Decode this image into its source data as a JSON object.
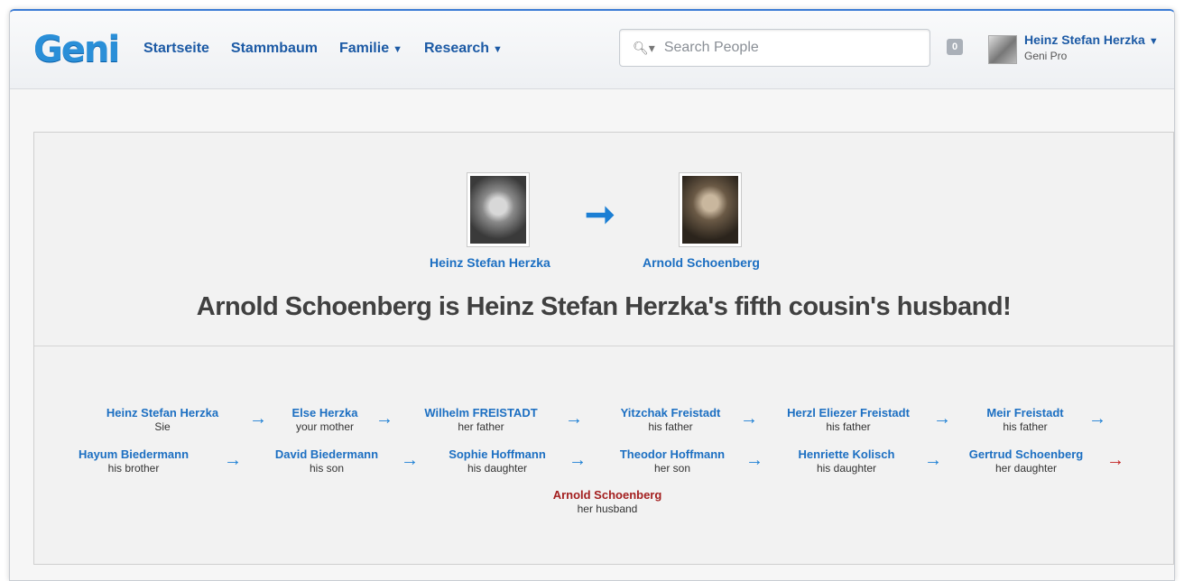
{
  "logo": "Geni",
  "nav": [
    {
      "label": "Startseite",
      "dropdown": false
    },
    {
      "label": "Stammbaum",
      "dropdown": false
    },
    {
      "label": "Familie",
      "dropdown": true
    },
    {
      "label": "Research",
      "dropdown": true
    }
  ],
  "search": {
    "placeholder": "Search People"
  },
  "notifications": {
    "count": "0"
  },
  "user": {
    "name": "Heinz Stefan Herzka",
    "subtitle": "Geni Pro"
  },
  "relationship": {
    "from": "Heinz Stefan Herzka",
    "to": "Arnold Schoenberg",
    "headline": "Arnold Schoenberg is Heinz Stefan Herzka's fifth cousin's husband!"
  },
  "path": [
    {
      "name": "Heinz Stefan Herzka",
      "relation": "Sie"
    },
    {
      "name": "Else Herzka",
      "relation": "your mother"
    },
    {
      "name": "Wilhelm FREISTADT",
      "relation": "her father"
    },
    {
      "name": "Yitzchak Freistadt",
      "relation": "his father"
    },
    {
      "name": "Herzl Eliezer Freistadt",
      "relation": "his father"
    },
    {
      "name": "Meir Freistadt",
      "relation": "his father"
    },
    {
      "name": "Hayum Biedermann",
      "relation": "his brother"
    },
    {
      "name": "David Biedermann",
      "relation": "his son"
    },
    {
      "name": "Sophie Hoffmann",
      "relation": "his daughter"
    },
    {
      "name": "Theodor Hoffmann",
      "relation": "her son"
    },
    {
      "name": "Henriette Kolisch",
      "relation": "his daughter"
    },
    {
      "name": "Gertrud Schoenberg",
      "relation": "her daughter"
    },
    {
      "name": "Arnold Schoenberg",
      "relation": "her husband"
    }
  ],
  "colors": {
    "brand": "#2a8fd8",
    "link": "#1c6fc2",
    "arrow": "#1c7fd4",
    "target": "#a31f1f"
  }
}
